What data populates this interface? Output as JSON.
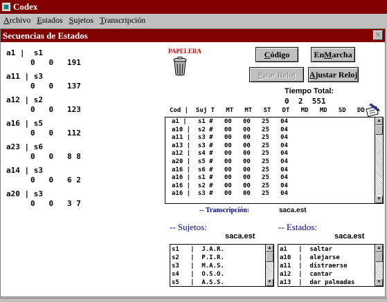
{
  "app": {
    "title": "Codex"
  },
  "menu": [
    {
      "label": "Archivo",
      "key": "A",
      "rest": "rchivo"
    },
    {
      "label": "Estados",
      "key": "E",
      "rest": "stados"
    },
    {
      "label": "Sujetos",
      "key": "S",
      "rest": "ujetos"
    },
    {
      "label": "Transcripción",
      "key": "T",
      "rest": "ranscripción"
    }
  ],
  "window": {
    "title": "Secuencias de Estados",
    "close": "✕"
  },
  "sequences": [
    {
      "head": "a1 |  s1",
      "nums": "0   0   191"
    },
    {
      "head": "a11 | s3",
      "nums": "0   0   137"
    },
    {
      "head": "a12 | s2",
      "nums": "0   0   123"
    },
    {
      "head": "a16 | s5",
      "nums": "0   0   112"
    },
    {
      "head": "a23 | s6",
      "nums": "0   0   8 8"
    },
    {
      "head": "a14 | s3",
      "nums": "0   0   6 2"
    },
    {
      "head": "a20 | s3",
      "nums": "0   0   3 7"
    }
  ],
  "papelera": {
    "label": "PAPELERA"
  },
  "buttons": {
    "codigo": {
      "key": "C",
      "rest": "ódigo"
    },
    "en_marcha": {
      "pre": "En ",
      "key": "M",
      "rest": "archa"
    },
    "parar_reloj": {
      "pre": "",
      "key": "P",
      "rest": "arar Reloj"
    },
    "ajustar_reloj": {
      "pre": "",
      "key": "A",
      "rest": "justar Reloj"
    }
  },
  "tiempo": {
    "label": "Tiempo Total:",
    "values": "0  2  551"
  },
  "table": {
    "header": "Cod |  Suj T   MT   MT   ST   DT   MD   MD   SD   DD",
    "rows": [
      "a1 |   s1 #   00   00   25   04",
      "a10 |  s2 #   00   00   25   04",
      "a11 |  s3 #   00   00   25   04",
      "a13 |  s3 #   00   00   25   04",
      "a12 |  s4 #   00   00   25   04",
      "a20 |  s5 #   00   00   25   04",
      "a16 |  s6 #   00   00   25   04",
      "a16 |  s1 #   00   00   25   04",
      "a16 |  s2 #   00   00   25   04",
      "a16 |  s3 #   00   00   25   04"
    ]
  },
  "transcripcion": {
    "label": "-- Transcripción:",
    "file": "saca.est"
  },
  "sujetos": {
    "label": "-- Sujetos:",
    "file": "saca.est",
    "items": [
      "s1   |  J.A.R.",
      "s2   |  P.I.R.",
      "s3   |  M.A.S.",
      "s4   |  O.S.O.",
      "s5   |  A.S.S."
    ]
  },
  "estados": {
    "label": "-- Estados:",
    "file": "saca.est",
    "items": [
      "a1   |  saltar",
      "a10  |  alejarse",
      "a11  |  distraerse",
      "a12  |  cantar",
      "a13  |  dar palmadas"
    ]
  }
}
